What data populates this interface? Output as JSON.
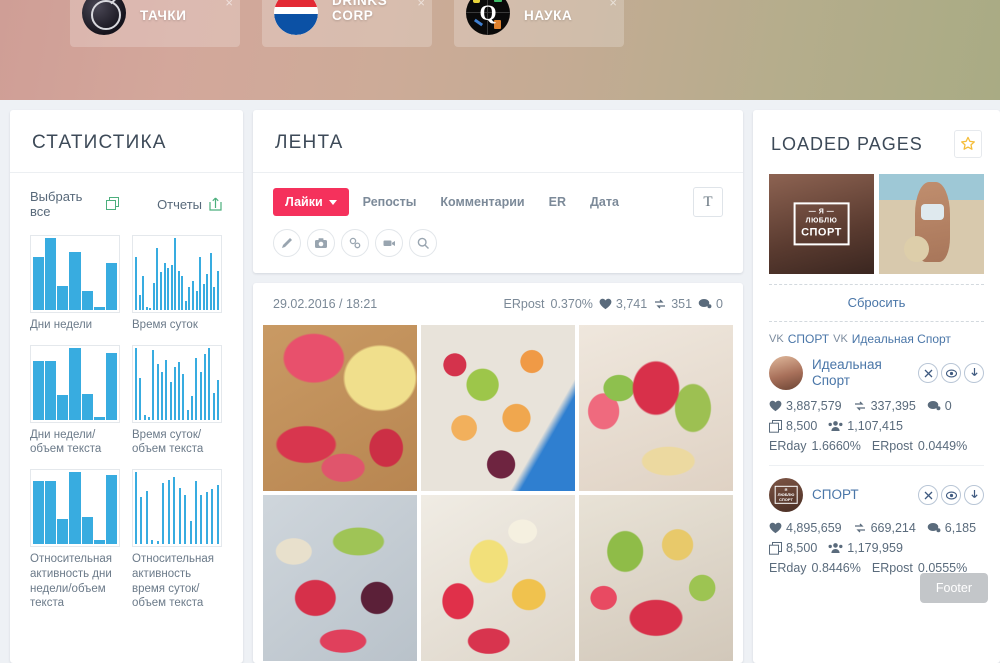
{
  "banner": {
    "cards": [
      {
        "name": "ТАЧКИ",
        "logo": "volvo-logo",
        "close": "×"
      },
      {
        "name": "DRINKS CORP",
        "logo": "pepsi-logo",
        "close": "×"
      },
      {
        "name": "НАУКА",
        "logo": "science-quiz-logo",
        "close": "×"
      }
    ]
  },
  "stats": {
    "title": "СТАТИСТИКА",
    "select_all": "Выбрать все",
    "select_all_icon": "copy-icon",
    "reports": "Отчеты",
    "reports_icon": "upload-icon",
    "charts": [
      {
        "label": "Дни недели",
        "type": "weekday",
        "values": [
          62,
          85,
          28,
          68,
          22,
          3,
          55
        ]
      },
      {
        "label": "Время суток",
        "type": "hourly",
        "values": [
          70,
          20,
          45,
          4,
          3,
          36,
          82,
          50,
          62,
          55,
          60,
          95,
          52,
          45,
          12,
          30,
          38,
          25,
          70,
          34,
          48,
          75,
          30,
          52
        ]
      },
      {
        "label": "Дни недели/ объем текста",
        "type": "weekday",
        "values": [
          72,
          72,
          30,
          88,
          32,
          4,
          82
        ]
      },
      {
        "label": "Время суток/ объем текста",
        "type": "hourly",
        "values": [
          90,
          52,
          6,
          4,
          88,
          70,
          60,
          75,
          48,
          66,
          72,
          58,
          12,
          30,
          78,
          60,
          82,
          90,
          34,
          50
        ]
      },
      {
        "label": "Относительная активность дни недели/объем текста",
        "type": "weekday",
        "values": [
          80,
          80,
          32,
          92,
          35,
          5,
          88
        ]
      },
      {
        "label": "Относительная активность время суток/ объем текста",
        "type": "hourly",
        "values": [
          92,
          60,
          68,
          5,
          4,
          78,
          82,
          86,
          72,
          62,
          30,
          80,
          62,
          66,
          70,
          76
        ]
      }
    ]
  },
  "feed": {
    "title": "ЛЕНТА",
    "filters": [
      {
        "label": "Лайки",
        "active": true,
        "caret": true
      },
      {
        "label": "Репосты",
        "active": false
      },
      {
        "label": "Комментарии",
        "active": false
      },
      {
        "label": "ER",
        "active": false
      },
      {
        "label": "Дата",
        "active": false
      }
    ],
    "text_button": "T",
    "tool_icons": [
      "pencil-icon",
      "camera-icon",
      "link-icon",
      "video-icon",
      "search-icon"
    ],
    "post": {
      "date": "29.02.2016 / 18:21",
      "er_label": "ERpost",
      "er_value": "0.370%",
      "likes": "3,741",
      "reposts": "351",
      "comments": "0"
    }
  },
  "loaded_pages": {
    "title": "LOADED PAGES",
    "star_icon": "star-icon",
    "reset": "Сбросить",
    "breadcrumb": [
      {
        "icon": "vk-icon",
        "label": "СПОРТ"
      },
      {
        "icon": "vk-icon",
        "label": "Идеальная Спорт"
      }
    ],
    "entries": [
      {
        "name": "Идеальная Спорт",
        "avatar": "woman-torso-avatar",
        "likes": "3,887,579",
        "reposts": "337,395",
        "comments": "0",
        "posts": "8,500",
        "followers": "1,107,415",
        "erday_label": "ERday",
        "erday": "1.6660%",
        "erpost_label": "ERpost",
        "erpost": "0.0449%",
        "buttons": [
          "close-icon",
          "eye-icon",
          "download-icon"
        ]
      },
      {
        "name": "СПОРТ",
        "avatar": "ya-lyublyu-sport-avatar",
        "likes": "4,895,659",
        "reposts": "669,214",
        "comments": "6,185",
        "posts": "8,500",
        "followers": "1,179,959",
        "erday_label": "ERday",
        "erday": "0.8446%",
        "erpost_label": "ERpost",
        "erpost": "0.0555%",
        "buttons": [
          "close-icon",
          "eye-icon",
          "download-icon"
        ]
      }
    ]
  },
  "tooltip": {
    "label": "Footer"
  },
  "colors": {
    "accent_pink": "#f5315c",
    "chart_blue": "#38ace0",
    "link_blue": "#4a76a8",
    "green": "#4caf7d",
    "star_yellow": "#f5bd3a"
  }
}
